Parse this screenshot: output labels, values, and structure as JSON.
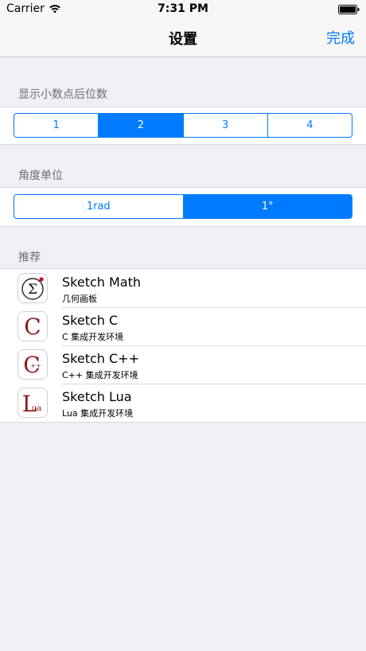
{
  "status_bar": {
    "carrier": "Carrier",
    "time": "7:31 PM"
  },
  "nav": {
    "title": "设置",
    "done_label": "完成"
  },
  "decimal_section": {
    "header": "显示小数点后位数",
    "options": [
      "1",
      "2",
      "3",
      "4"
    ],
    "selected": "2"
  },
  "angle_section": {
    "header": "角度单位",
    "options": [
      "1rad",
      "1°"
    ],
    "selected": "1°"
  },
  "recommend_section": {
    "header": "推荐",
    "apps": [
      {
        "name": "Sketch Math",
        "subtitle": "几何画板",
        "icon": "sigma-icon"
      },
      {
        "name": "Sketch C",
        "subtitle": "C 集成开发环境",
        "icon": "c-letter-icon"
      },
      {
        "name": "Sketch C++",
        "subtitle": "C++ 集成开发环境",
        "icon": "cpp-letter-icon"
      },
      {
        "name": "Sketch Lua",
        "subtitle": "Lua 集成开发环境",
        "icon": "lua-letter-icon"
      }
    ]
  },
  "colors": {
    "accent": "#007aff",
    "app_icon_red": "#8b1a1a",
    "background": "#efeff4"
  }
}
